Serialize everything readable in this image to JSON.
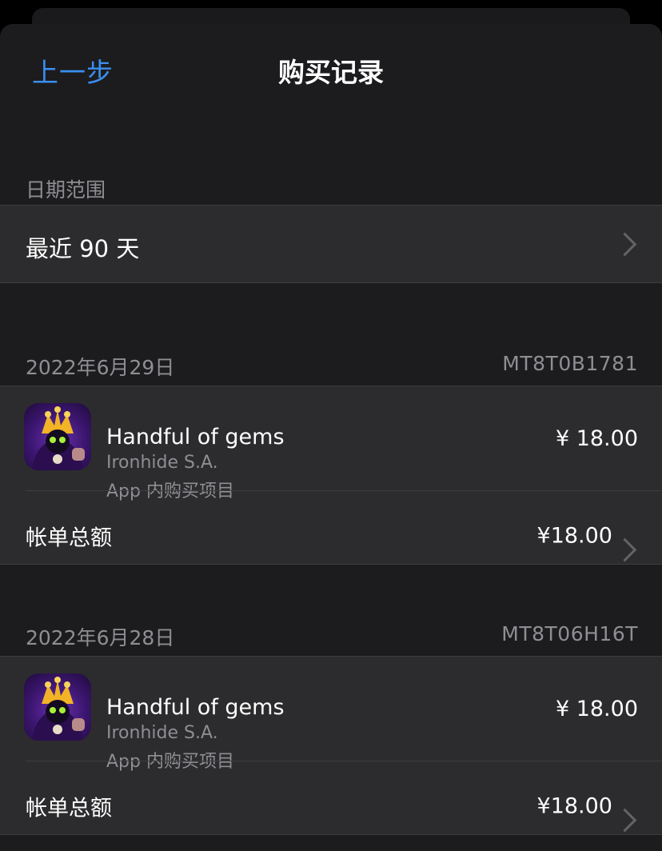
{
  "nav": {
    "back_label": "上一步",
    "title": "购买记录"
  },
  "date_range": {
    "header": "日期范围",
    "value": "最近 90 天"
  },
  "purchases": [
    {
      "date": "2022年6月29日",
      "order_id": "MT8T0B1781",
      "item": {
        "name": "Handful of gems",
        "developer": "Ironhide S.A.",
        "type": "App 内购买项目",
        "price": "¥ 18.00"
      },
      "total_label": "帐单总额",
      "total_value": "¥18.00"
    },
    {
      "date": "2022年6月28日",
      "order_id": "MT8T06H16T",
      "item": {
        "name": "Handful of gems",
        "developer": "Ironhide S.A.",
        "type": "App 内购买项目",
        "price": "¥ 18.00"
      },
      "total_label": "帐单总额",
      "total_value": "¥18.00"
    }
  ],
  "colors": {
    "accent": "#3a8ef0",
    "background": "#1c1c1e",
    "cell": "#2c2c2e",
    "secondary_text": "#8e8e93"
  }
}
